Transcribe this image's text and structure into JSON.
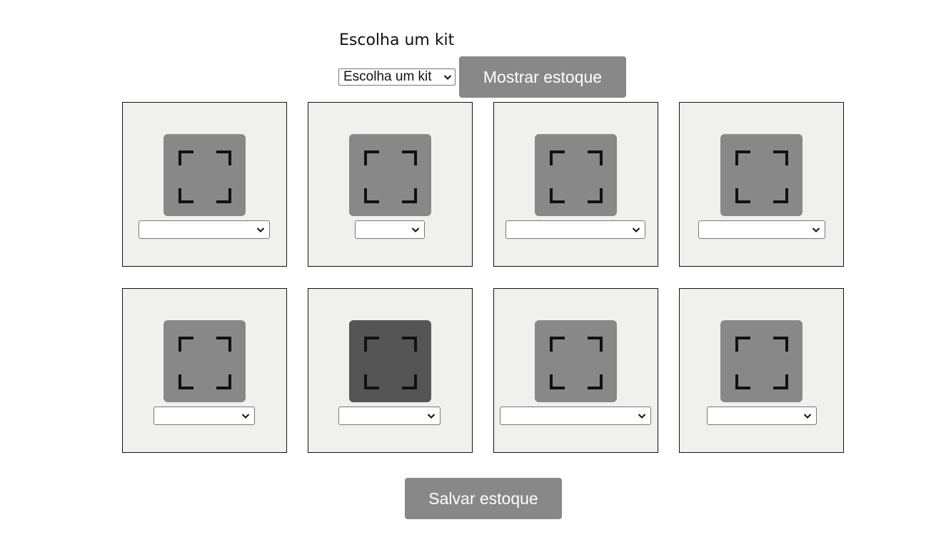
{
  "header": {
    "title": "Escolha um kit",
    "kit_select_value": "Escolha um kit",
    "show_button": "Mostrar estoque"
  },
  "footer": {
    "save_button": "Salvar estoque"
  },
  "icons": {
    "tile_icon": "fullscreen-corners-icon",
    "select_arrow": "chevron-down-icon"
  },
  "colors": {
    "button_bg": "#888888",
    "tile_bg": "#888888",
    "tile_active_bg": "#555555",
    "card_bg": "#f0f0ef"
  },
  "slots": [
    {
      "selected": "",
      "active": false
    },
    {
      "selected": "",
      "active": false
    },
    {
      "selected": "",
      "active": false
    },
    {
      "selected": "",
      "active": false
    },
    {
      "selected": "",
      "active": false
    },
    {
      "selected": "",
      "active": true
    },
    {
      "selected": "",
      "active": false
    },
    {
      "selected": "",
      "active": false
    }
  ]
}
